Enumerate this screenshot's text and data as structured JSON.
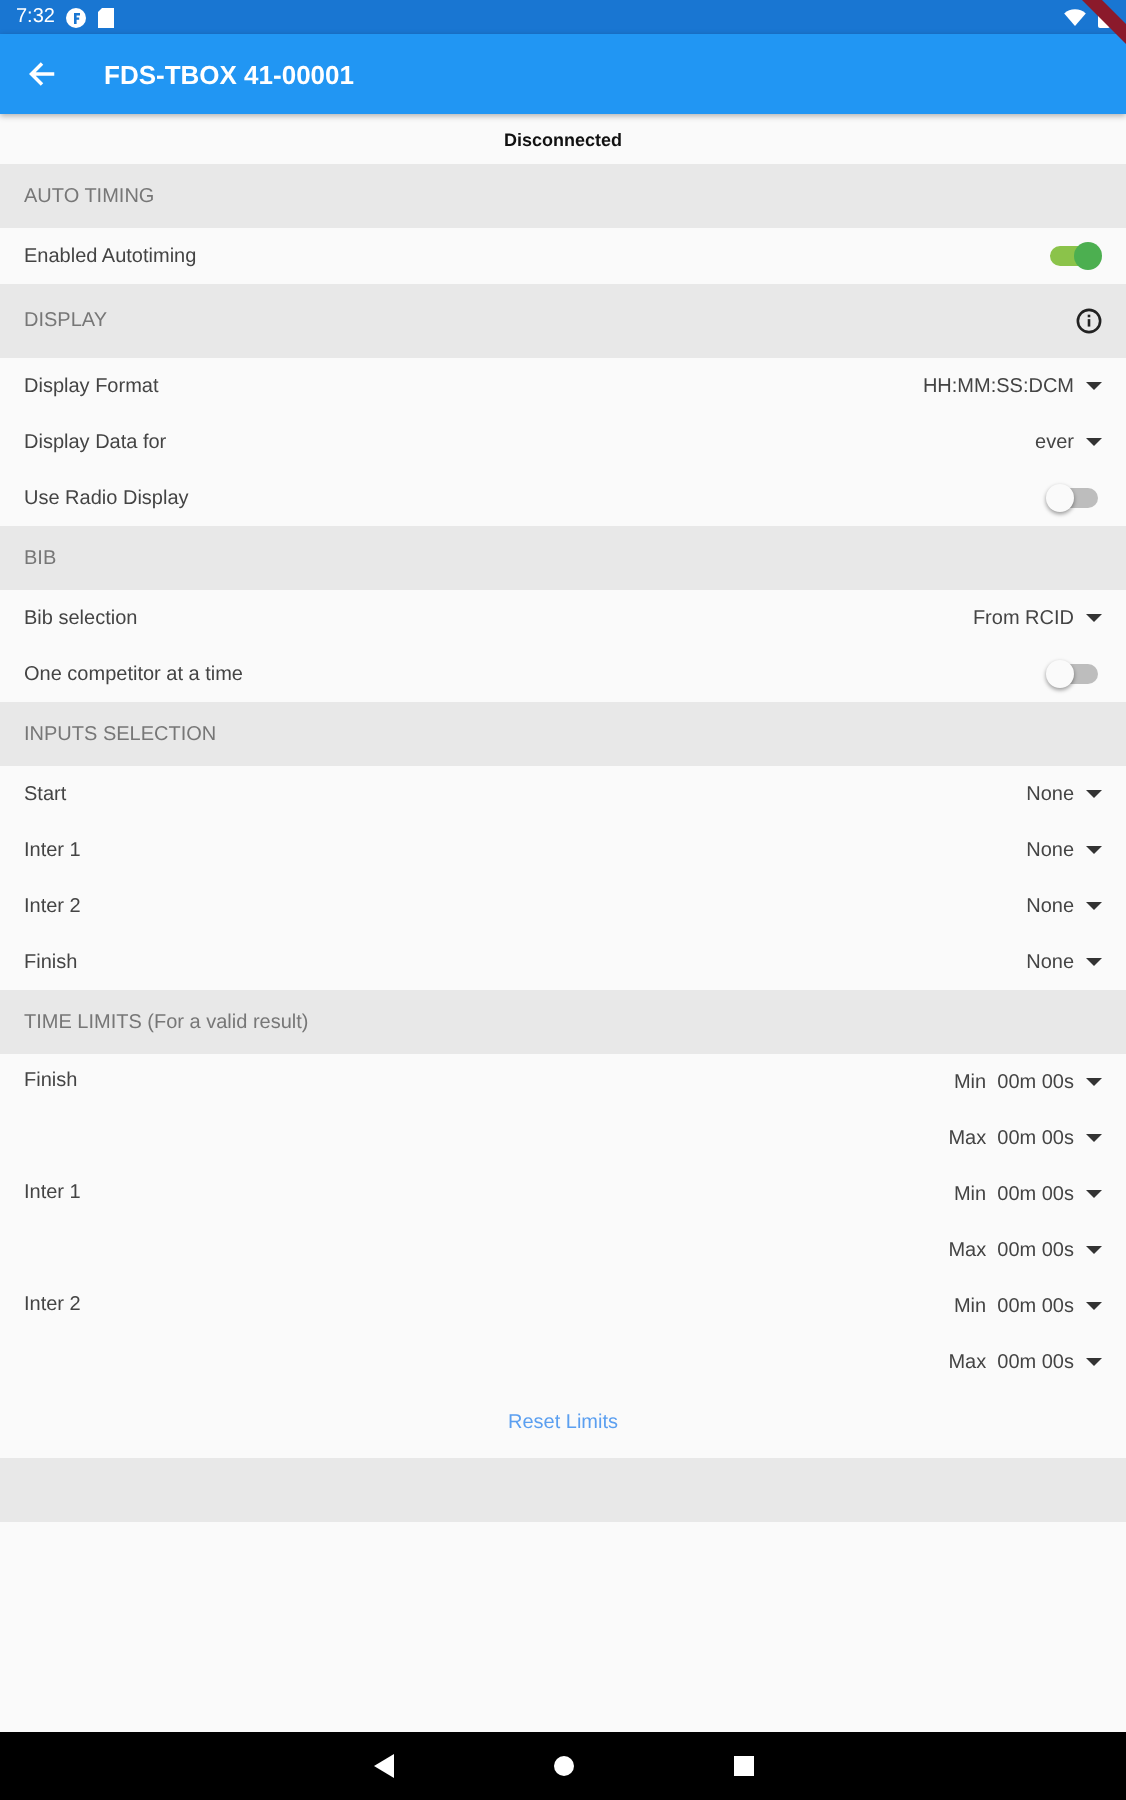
{
  "status_bar": {
    "time": "7:32"
  },
  "app_bar": {
    "title": "FDS-TBOX 41-00001"
  },
  "connection": "Disconnected",
  "sections": [
    {
      "title": "AUTO TIMING",
      "info": false,
      "items": [
        {
          "kind": "toggle",
          "label": "Enabled Autotiming",
          "on": true
        }
      ]
    },
    {
      "title": "DISPLAY",
      "info": true,
      "items": [
        {
          "kind": "dropdown",
          "label": "Display Format",
          "value": "HH:MM:SS:DCM"
        },
        {
          "kind": "dropdown",
          "label": "Display Data for",
          "value": "ever"
        },
        {
          "kind": "toggle",
          "label": "Use Radio Display",
          "on": false
        }
      ]
    },
    {
      "title": "BIB",
      "info": false,
      "items": [
        {
          "kind": "dropdown",
          "label": "Bib selection",
          "value": "From RCID"
        },
        {
          "kind": "toggle",
          "label": "One competitor at a time",
          "on": false
        }
      ]
    },
    {
      "title": "INPUTS SELECTION",
      "info": false,
      "items": [
        {
          "kind": "dropdown",
          "label": "Start",
          "value": "None"
        },
        {
          "kind": "dropdown",
          "label": "Inter 1",
          "value": "None"
        },
        {
          "kind": "dropdown",
          "label": "Inter 2",
          "value": "None"
        },
        {
          "kind": "dropdown",
          "label": "Finish",
          "value": "None"
        }
      ]
    },
    {
      "title": "TIME LIMITS (For a valid result)",
      "info": false,
      "items": [
        {
          "kind": "limits",
          "label": "Finish",
          "limits": [
            {
              "prefix": "Min",
              "value": "00m 00s"
            },
            {
              "prefix": "Max",
              "value": "00m 00s"
            }
          ]
        },
        {
          "kind": "limits",
          "label": "Inter 1",
          "limits": [
            {
              "prefix": "Min",
              "value": "00m 00s"
            },
            {
              "prefix": "Max",
              "value": "00m 00s"
            }
          ]
        },
        {
          "kind": "limits",
          "label": "Inter 2",
          "limits": [
            {
              "prefix": "Min",
              "value": "00m 00s"
            },
            {
              "prefix": "Max",
              "value": "00m 00s"
            }
          ]
        }
      ],
      "action": "Reset Limits"
    }
  ]
}
